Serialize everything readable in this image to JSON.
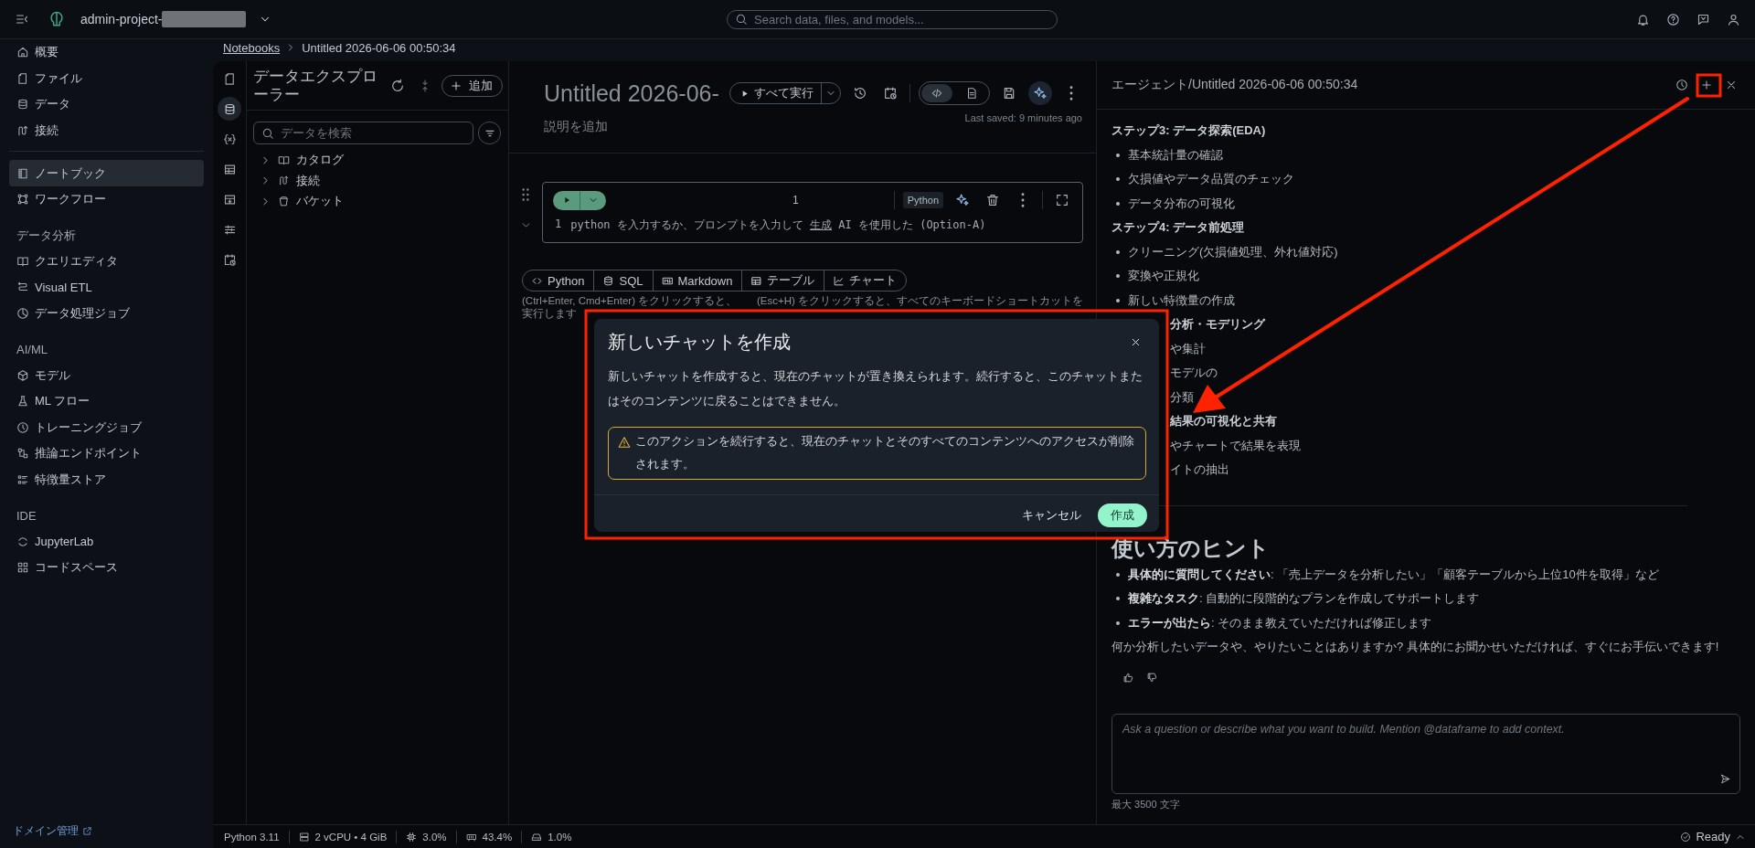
{
  "topbar": {
    "project": "admin-project-",
    "search_placeholder": "Search data, files, and models..."
  },
  "sidebar": {
    "groups": [
      {
        "items": [
          {
            "label": "概要",
            "selected": false
          },
          {
            "label": "ファイル",
            "selected": false
          },
          {
            "label": "データ",
            "selected": false
          },
          {
            "label": "接続",
            "selected": false
          }
        ]
      },
      {
        "items": [
          {
            "label": "ノートブック",
            "selected": true
          },
          {
            "label": "ワークフロー",
            "selected": false
          }
        ]
      },
      {
        "title": "データ分析",
        "items": [
          {
            "label": "クエリエディタ",
            "selected": false
          },
          {
            "label": "Visual ETL",
            "selected": false
          },
          {
            "label": "データ処理ジョブ",
            "selected": false
          }
        ]
      },
      {
        "title": "AI/ML",
        "items": [
          {
            "label": "モデル",
            "selected": false
          },
          {
            "label": "ML フロー",
            "selected": false
          },
          {
            "label": "トレーニングジョブ",
            "selected": false
          },
          {
            "label": "推論エンドポイント",
            "selected": false
          },
          {
            "label": "特徴量ストア",
            "selected": false
          }
        ]
      },
      {
        "title": "IDE",
        "items": [
          {
            "label": "JupyterLab",
            "selected": false
          },
          {
            "label": "コードスペース",
            "selected": false
          }
        ]
      }
    ],
    "footer_link": "ドメイン管理"
  },
  "breadcrumb": [
    {
      "label": "Notebooks",
      "kind": "link"
    },
    {
      "label": "Untitled 2026-06-06 00:50:34",
      "kind": "current"
    }
  ],
  "rail": [
    {
      "selected": false
    },
    {
      "selected": true
    },
    {
      "selected": false
    },
    {
      "selected": false
    },
    {
      "selected": false
    },
    {
      "selected": false
    },
    {
      "selected": false
    }
  ],
  "explorer": {
    "title": "データエクスプローラー",
    "add_button": "追加",
    "search_placeholder": "データを検索",
    "tree": [
      {
        "label": "カタログ",
        "expanded": false
      },
      {
        "label": "接続",
        "expanded": false
      },
      {
        "label": "バケット",
        "expanded": false
      }
    ]
  },
  "notebook": {
    "title": "Untitled 2026-06-",
    "run_all": "すべて実行",
    "view_toggle": [
      {
        "selected": true
      },
      {
        "selected": false
      }
    ],
    "assistant_active": true,
    "description_placeholder": "説明を追加",
    "last_saved": "Last saved: 9 minutes ago",
    "cell": {
      "execution_count": "1",
      "language": "Python",
      "line_number": "1",
      "code_before": "python を入力するか、プロンプトを入力して ",
      "code_link": "生成",
      "code_after": " AI を使用した (Option-A)"
    },
    "add_cell": [
      "Python",
      "SQL",
      "Markdown",
      "テーブル",
      "チャート"
    ],
    "hints": [
      "(Ctrl+Enter, Cmd+Enter) をクリックすると、実行します",
      "(Esc+H) をクリックすると、すべてのキーボードショートカットを"
    ]
  },
  "agent": {
    "title": "エージェント/Untitled 2026-06-06 00:50:34",
    "messages": [
      {
        "kind": "heading",
        "text": "ステップ3: データ探索(EDA)",
        "covered": false
      },
      {
        "kind": "bullet",
        "text": "基本統計量の確認",
        "covered": false
      },
      {
        "kind": "bullet",
        "text": "欠損値やデータ品質のチェック",
        "covered": false
      },
      {
        "kind": "bullet",
        "text": "データ分布の可視化",
        "covered": false
      },
      {
        "kind": "heading",
        "text": "ステップ4: データ前処理",
        "covered": false
      },
      {
        "kind": "bullet",
        "text": "クリーニング(欠損値処理、外れ値対応)",
        "covered": false
      },
      {
        "kind": "bullet",
        "text": "変換や正規化",
        "covered": false
      },
      {
        "kind": "bullet",
        "text": "新しい特徴量の作成",
        "covered": false
      },
      {
        "kind": "heading",
        "text": "分析・モデリング",
        "covered": true
      },
      {
        "kind": "bullet",
        "text": "や集計",
        "covered": true
      },
      {
        "kind": "bullet",
        "text": "モデルの",
        "covered": true
      },
      {
        "kind": "bullet",
        "text": "分類",
        "covered": true
      },
      {
        "kind": "heading",
        "text": "結果の可視化と共有",
        "covered": true
      },
      {
        "kind": "bullet",
        "text": "やチャートで結果を表現",
        "covered": true
      },
      {
        "kind": "bullet",
        "text": "イトの抽出",
        "covered": true
      }
    ],
    "tips_title": "使い方のヒント",
    "tips": [
      "**具体的に質問してください**: 「売上データを分析したい」「顧客テーブルから上位10件を取得」など",
      "**複雑なタスク**: 自動的に段階的なプランを作成してサポートします",
      "**エラーが出たら**: そのまま教えていただければ修正します"
    ],
    "closing": "何か分析したいデータや、やりたいことはありますか? 具体的にお聞かせいただければ、すぐにお手伝いできます!",
    "input_placeholder": "Ask a question or describe what you want to build. Mention @dataframe to add context.",
    "char_limit": "最大 3500 文字"
  },
  "modal": {
    "title": "新しいチャットを作成",
    "body": "新しいチャットを作成すると、現在のチャットが置き換えられます。続行すると、このチャットまたはそのコンテンツに戻ることはできません。",
    "warning": "このアクションを続行すると、現在のチャットとそのすべてのコンテンツへのアクセスが削除されます。",
    "cancel": "キャンセル",
    "confirm": "作成"
  },
  "status_bar": {
    "runtime": "Python 3.11",
    "compute": "2 vCPU • 4 GiB",
    "cpu": "3.0%",
    "memory": "43.4%",
    "disk": "1.0%",
    "state": "Ready"
  }
}
